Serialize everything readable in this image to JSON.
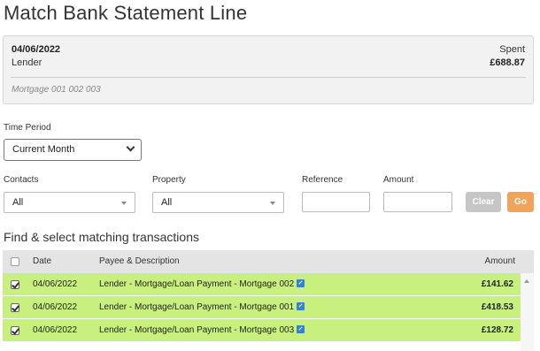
{
  "page": {
    "title": "Match Bank Statement Line"
  },
  "statement": {
    "date": "04/06/2022",
    "payee": "Lender",
    "spent_label": "Spent",
    "spent_amount": "£688.87",
    "description": "Mortgage 001 002 003"
  },
  "filters": {
    "time_period": {
      "label": "Time Period",
      "value": "Current Month"
    },
    "contacts": {
      "label": "Contacts",
      "value": "All"
    },
    "property": {
      "label": "Property",
      "value": "All"
    },
    "reference": {
      "label": "Reference",
      "value": ""
    },
    "amount": {
      "label": "Amount",
      "value": ""
    },
    "clear_label": "Clear",
    "go_label": "Go"
  },
  "transactions": {
    "section_title": "Find & select matching transactions",
    "columns": {
      "date": "Date",
      "payee": "Payee & Description",
      "amount": "Amount"
    },
    "rows": [
      {
        "date": "04/06/2022",
        "payee": "Lender - Mortgage/Loan Payment - Mortgage 002",
        "amount": "£141.62",
        "checked": true
      },
      {
        "date": "04/06/2022",
        "payee": "Lender - Mortgage/Loan Payment - Mortgage 001",
        "amount": "£418.53",
        "checked": true
      },
      {
        "date": "04/06/2022",
        "payee": "Lender - Mortgage/Loan Payment - Mortgage 003",
        "amount": "£128.72",
        "checked": true
      }
    ]
  },
  "colors": {
    "row_highlight": "#c8f07e",
    "go_button": "#f0a45a",
    "clear_button": "#c6c6c6",
    "link_icon": "#2f82d8"
  },
  "icons": {
    "dropdown": "chevron-down-icon",
    "select_arrow": "triangle-down-icon",
    "external_link": "external-link-icon",
    "checkbox": "checkbox-icon"
  }
}
